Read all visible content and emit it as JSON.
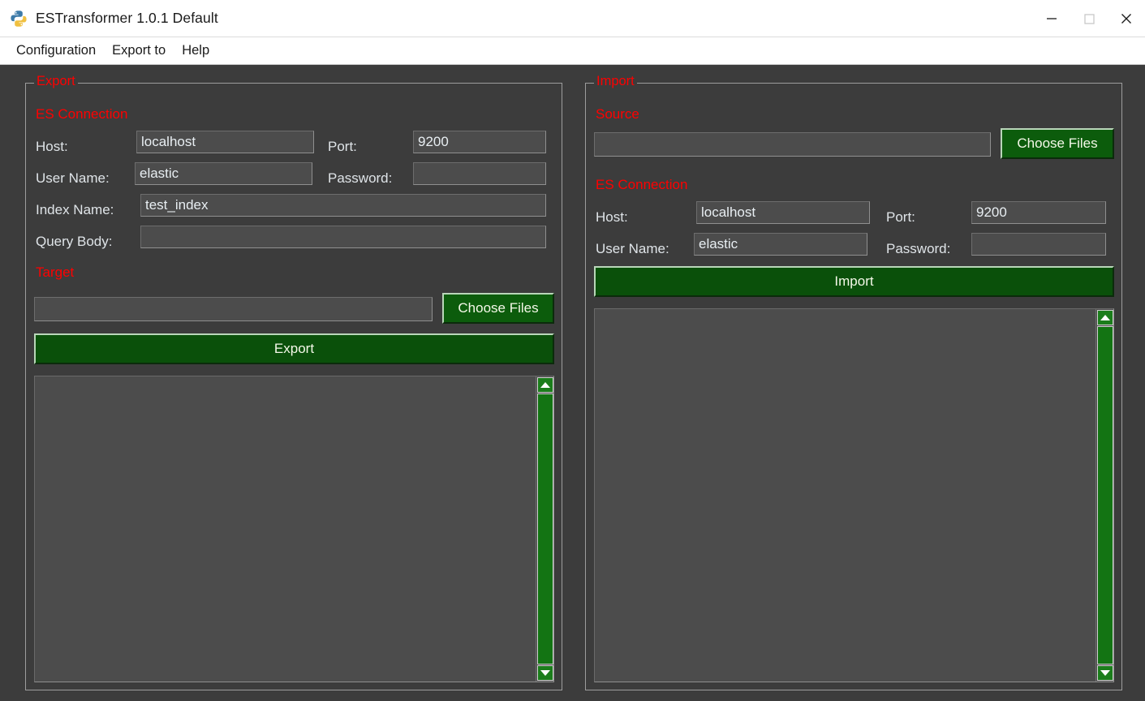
{
  "window": {
    "title": "ESTransformer 1.0.1 Default",
    "icon": "python-logo-icon",
    "controls": {
      "minimize": "minimize-icon",
      "maximize": "maximize-icon",
      "close": "close-icon"
    }
  },
  "menubar": {
    "items": [
      {
        "label": "Configuration"
      },
      {
        "label": "Export to"
      },
      {
        "label": "Help"
      }
    ]
  },
  "export_panel": {
    "title": "Export",
    "es_connection": {
      "title": "ES Connection",
      "host_label": "Host:",
      "host_value": "localhost",
      "port_label": "Port:",
      "port_value": "9200",
      "user_label": "User Name:",
      "user_value": "elastic",
      "password_label": "Password:",
      "password_value": "",
      "index_label": "Index Name:",
      "index_value": "test_index",
      "query_label": "Query Body:",
      "query_value": ""
    },
    "target": {
      "title": "Target",
      "path_value": "",
      "choose_files_label": "Choose Files"
    },
    "export_button_label": "Export",
    "log_value": ""
  },
  "import_panel": {
    "title": "Import",
    "source": {
      "title": "Source",
      "path_value": "",
      "choose_files_label": "Choose Files"
    },
    "es_connection": {
      "title": "ES Connection",
      "host_label": "Host:",
      "host_value": "localhost",
      "port_label": "Port:",
      "port_value": "9200",
      "user_label": "User Name:",
      "user_value": "elastic",
      "password_label": "Password:",
      "password_value": ""
    },
    "import_button_label": "Import",
    "log_value": ""
  },
  "colors": {
    "background": "#3c3c3c",
    "field_fill": "#4c4c4c",
    "group_title": "#ff0000",
    "label": "#dfe4e8",
    "button_green": "#0a500a",
    "scroll_green": "#137413"
  }
}
